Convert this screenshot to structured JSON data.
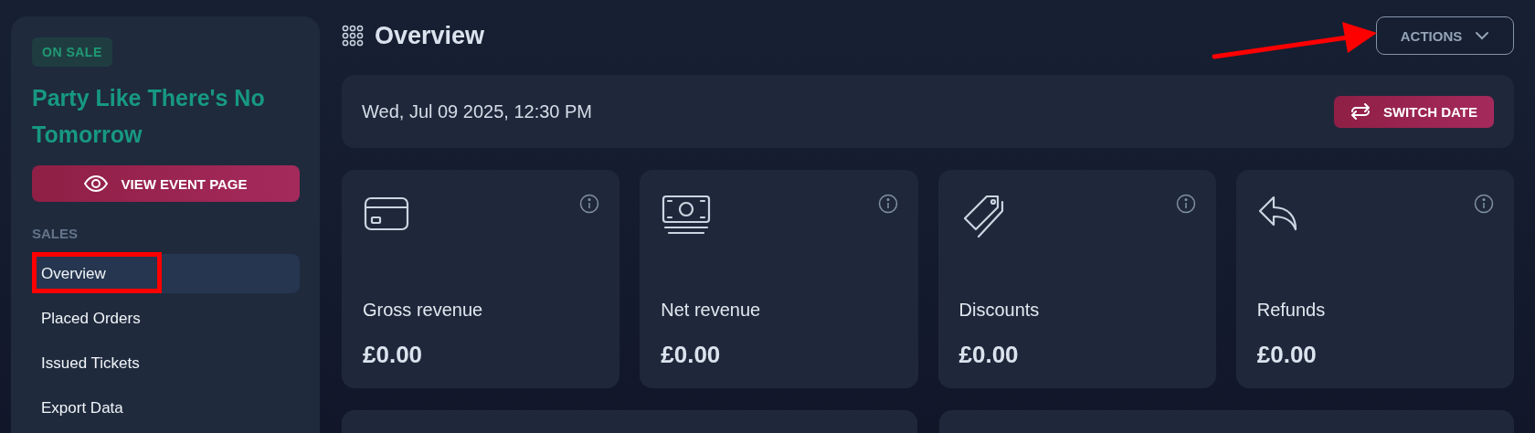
{
  "sidebar": {
    "status_badge": "ON SALE",
    "event_title": "Party Like There's No Tomorrow",
    "view_button": "VIEW EVENT PAGE",
    "section_label": "SALES",
    "items": [
      {
        "label": "Overview",
        "selected": true
      },
      {
        "label": "Placed Orders",
        "selected": false
      },
      {
        "label": "Issued Tickets",
        "selected": false
      },
      {
        "label": "Export Data",
        "selected": false
      }
    ]
  },
  "header": {
    "title": "Overview",
    "actions_button": "ACTIONS"
  },
  "date_card": {
    "date": "Wed, Jul 09 2025, 12:30 PM",
    "switch_button": "SWITCH DATE"
  },
  "stats": [
    {
      "kind": "card",
      "label": "Gross revenue",
      "value": "£0.00"
    },
    {
      "kind": "cash",
      "label": "Net revenue",
      "value": "£0.00"
    },
    {
      "kind": "tag",
      "label": "Discounts",
      "value": "£0.00"
    },
    {
      "kind": "refund",
      "label": "Refunds",
      "value": "£0.00"
    }
  ],
  "annotations": {
    "arrow": true,
    "highlight_box": true
  }
}
